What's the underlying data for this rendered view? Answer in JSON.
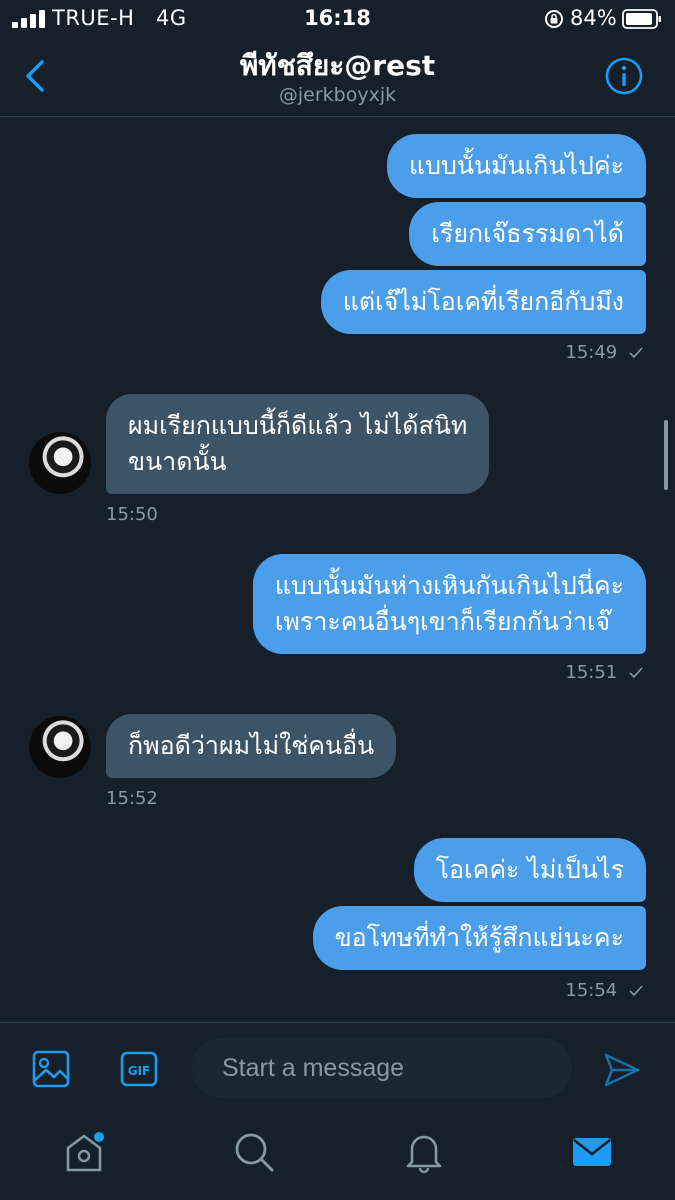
{
  "status_bar": {
    "carrier": "TRUE-H",
    "network": "4G",
    "time": "16:18",
    "battery": "84%"
  },
  "header": {
    "title": "พีทัชสึยะ@rest",
    "handle": "@jerkboyxjk"
  },
  "messages": [
    {
      "direction": "out",
      "text": "แบบนั้นมันเกินไปค่ะ"
    },
    {
      "direction": "out",
      "text": "เรียกเจ๊ธรรมดาได้"
    },
    {
      "direction": "out",
      "text": "แต่เจ๊ไม่โอเคที่เรียกอีกับมึง",
      "time": "15:49"
    },
    {
      "direction": "in",
      "lines": [
        "ผมเรียกแบบนี้ก็ดีแล้ว ไม่ได้สนิท",
        "ขนาดนั้น"
      ],
      "time": "15:50"
    },
    {
      "direction": "out",
      "lines": [
        "แบบนั้นมันห่างเหินกันเกินไปนี่คะ",
        "เพราะคนอื่นๆเขาก็เรียกกันว่าเจ๊"
      ],
      "time": "15:51"
    },
    {
      "direction": "in",
      "text": "ก็พอดีว่าผมไม่ใช่คนอื่น",
      "time": "15:52"
    },
    {
      "direction": "out",
      "text": "โอเคค่ะ ไม่เป็นไร"
    },
    {
      "direction": "out",
      "text": "ขอโทษที่ทำให้รู้สึกแย่นะคะ",
      "time": "15:54"
    }
  ],
  "composer": {
    "placeholder": "Start a message",
    "gif_label": "GIF"
  },
  "icons": {
    "back": "chevron-left-icon",
    "info": "info-icon",
    "image": "image-icon",
    "gif": "gif-icon",
    "send": "send-icon",
    "home": "home-icon",
    "search": "search-icon",
    "notifications": "bell-icon",
    "messages": "mail-icon"
  },
  "colors": {
    "background": "#15202b",
    "accent": "#1d9bf0",
    "outgoing_bubble": "#4a9eea",
    "incoming_bubble": "#3d5466",
    "muted_text": "#8899a6"
  }
}
